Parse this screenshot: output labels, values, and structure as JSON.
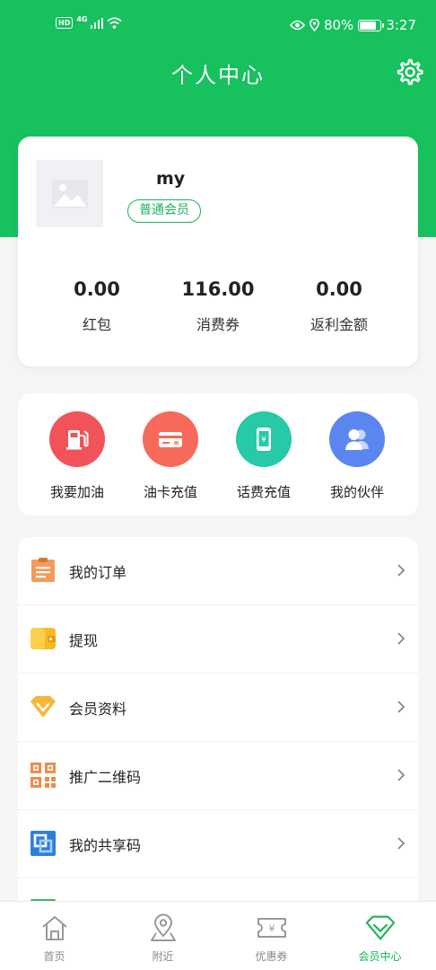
{
  "status_bar": {
    "hd": "HD",
    "network": "4G",
    "battery_percent": "80%",
    "battery_level": 0.8,
    "time": "3:27"
  },
  "header": {
    "title": "个人中心",
    "settings_icon": "gear-icon",
    "background_color": "#17c15e"
  },
  "profile": {
    "username": "my",
    "member_level": "普通会员",
    "stats": [
      {
        "value": "0.00",
        "label": "红包"
      },
      {
        "value": "116.00",
        "label": "消费券"
      },
      {
        "value": "0.00",
        "label": "返利金额"
      }
    ]
  },
  "quick_actions": [
    {
      "label": "我要加油",
      "icon": "fuel-pump-icon",
      "color": "#f0545a"
    },
    {
      "label": "油卡充值",
      "icon": "card-icon",
      "color": "#f7695a"
    },
    {
      "label": "话费充值",
      "icon": "phone-recharge-icon",
      "color": "#27c9a6"
    },
    {
      "label": "我的伙伴",
      "icon": "partners-icon",
      "color": "#5b86f0"
    }
  ],
  "menu": [
    {
      "label": "我的订单",
      "icon": "order-icon"
    },
    {
      "label": "提现",
      "icon": "wallet-icon"
    },
    {
      "label": "会员资料",
      "icon": "diamond-icon"
    },
    {
      "label": "推广二维码",
      "icon": "qrcode-icon"
    },
    {
      "label": "我的共享码",
      "icon": "share-code-icon"
    }
  ],
  "tabbar": {
    "active_color": "#17b45a",
    "tabs": [
      {
        "label": "首页",
        "icon": "home-icon",
        "active": false
      },
      {
        "label": "附近",
        "icon": "location-icon",
        "active": false
      },
      {
        "label": "优惠券",
        "icon": "coupon-icon",
        "active": false
      },
      {
        "label": "会员中心",
        "icon": "member-center-icon",
        "active": true
      }
    ]
  }
}
